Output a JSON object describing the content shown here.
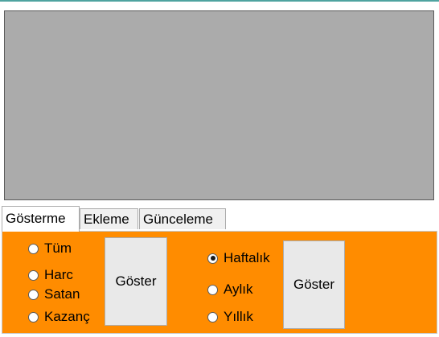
{
  "tabs": [
    {
      "label": "Gösterme",
      "active": true
    },
    {
      "label": "Ekleme",
      "active": false
    },
    {
      "label": "Günceleme",
      "active": false
    }
  ],
  "category_radios": [
    {
      "label": "Tüm",
      "checked": false
    },
    {
      "label": "Harc",
      "checked": false
    },
    {
      "label": "Satan",
      "checked": false
    },
    {
      "label": "Kazanç",
      "checked": false
    }
  ],
  "show_button_left": "Göster",
  "period_radios": [
    {
      "label": "Haftalık",
      "checked": true
    },
    {
      "label": "Aylık",
      "checked": false
    },
    {
      "label": "Yıllık",
      "checked": false
    }
  ],
  "show_button_right": "Göster",
  "colors": {
    "panel": "#ff8c00",
    "grid": "#ababab",
    "accent_line": "#4fa3a0"
  }
}
